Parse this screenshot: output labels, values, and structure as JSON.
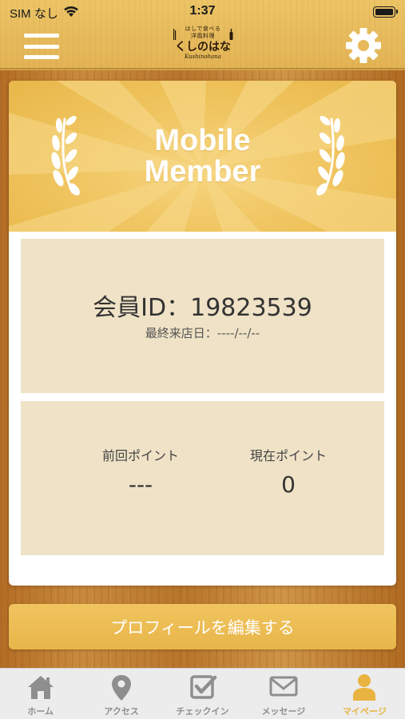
{
  "status_bar": {
    "carrier": "SIM なし",
    "time": "1:37"
  },
  "header": {
    "menu_icon": "hamburger-menu-icon",
    "settings_icon": "gear-icon",
    "logo": {
      "tagline": "はしで食べる",
      "subtitle": "洋風料理",
      "name": "くしのはな",
      "roman": "Kushinohana"
    }
  },
  "card": {
    "banner_title_line1": "Mobile",
    "banner_title_line2": "Member",
    "member_id_label": "会員ID：",
    "member_id": "19823539",
    "last_visit_label": "最終来店日：",
    "last_visit_value": "----/--/--",
    "previous_points_label": "前回ポイント",
    "previous_points_value": "---",
    "current_points_label": "現在ポイント",
    "current_points_value": "0"
  },
  "edit_profile_button": "プロフィールを編集する",
  "tabs": [
    {
      "label": "ホーム",
      "icon": "home-icon",
      "active": false
    },
    {
      "label": "アクセス",
      "icon": "map-pin-icon",
      "active": false
    },
    {
      "label": "チェックイン",
      "icon": "checkbox-icon",
      "active": false
    },
    {
      "label": "メッセージ",
      "icon": "envelope-icon",
      "active": false
    },
    {
      "label": "マイページ",
      "icon": "person-icon",
      "active": true
    }
  ],
  "colors": {
    "accent": "#e8b340",
    "banner": "#efc35d",
    "panel": "#efe2c6",
    "tab_inactive": "#8e8e8e"
  }
}
